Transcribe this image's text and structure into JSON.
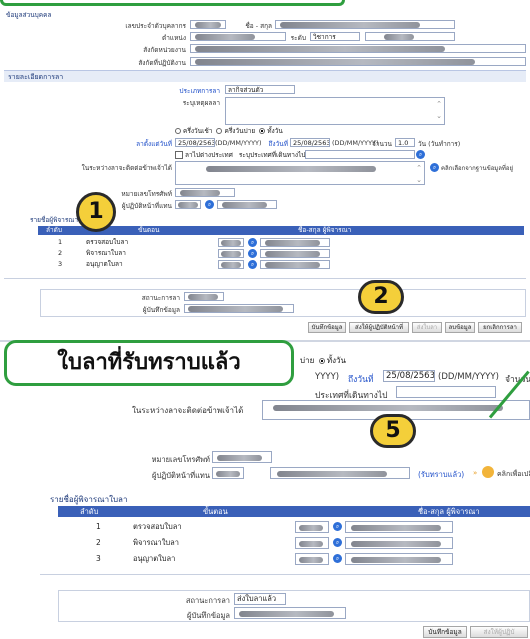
{
  "top": {
    "personal_header": "ข้อมูลส่วนบุคคล",
    "id_label": "เลขประจำตัวบุคลากร",
    "name_label": "ชื่อ - สกุล",
    "position_label": "ตำแหน่ง",
    "level_label": "ระดับ",
    "level_value": "วิชาการ",
    "org_label": "สังกัดหน่วยงาน",
    "org2_label": "สังกัดที่ปฏิบัติงาน",
    "leave_header": "รายละเอียดการลา",
    "leave_type_label": "ประเภทการลา",
    "leave_type_value": "ลากิจส่วนตัว",
    "reason_label": "ระบุเหตุผลลา",
    "radio_morning": "ครึ่งวันเช้า",
    "radio_afternoon": "ครึ่งวันบ่าย",
    "radio_full": "ทั้งวัน",
    "from_label": "ลาตั้งแต่วันที่",
    "from_date": "25/08/2563",
    "date_format": "(DD/MM/YYYY)",
    "to_label": "ถึงวันที่",
    "to_date": "25/08/2563",
    "days_label": "จำนวน",
    "days_value": "1.0",
    "days_unit": "วัน (วันทำการ)",
    "abroad_label": "ลาไปต่างประเทศ",
    "abroad_purpose_label": "ระบุประเทศที่เดินทางไป",
    "contact_label": "ในระหว่างลาจะติดต่อข้าพเจ้าได้",
    "contact_link": "คลิกเลือกจากฐานข้อมูลที่อยู่",
    "phone_label": "หมายเลขโทรศัพท์",
    "phone_value": "0xxxxxxxxx",
    "deputy_label": "ผู้ปฏิบัติหน้าที่แทน",
    "approver_header": "รายชื่อผู้พิจารณาใบลา",
    "col_order": "ลำดับ",
    "col_step": "ขั้นตอน",
    "col_name": "ชื่อ-สกุล ผู้พิจารณา",
    "rows": [
      {
        "no": "1",
        "step": "ตรวจสอบใบลา"
      },
      {
        "no": "2",
        "step": "พิจารณาใบลา"
      },
      {
        "no": "3",
        "step": "อนุญาตใบลา"
      }
    ],
    "status_label": "สถานะการลา",
    "recorder_label": "ผู้บันทึกข้อมูล",
    "buttons": [
      "บันทึกข้อมูล",
      "ส่งให้ผู้ปฏิบัติหน้าที่",
      "ส่งใบลา",
      "ลบข้อมูล",
      "ยกเลิกการลา"
    ]
  },
  "callout": {
    "text": "ใบลาที่รับทราบแล้ว"
  },
  "badges": {
    "b1": "1",
    "b2": "2",
    "b5": "5"
  },
  "bottom": {
    "radio_afternoon": "บ่าย",
    "radio_full": "ทั้งวัน",
    "date_format_partial": "YYYY)",
    "to_label": "ถึงวันที่",
    "to_date": "25/08/2563",
    "date_format": "(DD/MM/YYYY)",
    "days_partial": "จำนวน",
    "abroad_partial": "ประเทศที่เดินทางไป",
    "contact_partial": "ในระหว่างลาจะติดต่อข้าพเจ้าได้",
    "phone_label": "หมายเลขโทรศัพท์",
    "deputy_label": "ผู้ปฏิบัติหน้าที่แทน",
    "ack_status": "(รับทราบแล้ว)",
    "change_link": "คลิกเพื่อเปลี่ยนผู้ปฏิ",
    "approver_header": "รายชื่อผู้พิจารณาใบลา",
    "col_order": "ลำดับ",
    "col_step": "ขั้นตอน",
    "col_name": "ชื่อ-สกุล ผู้พิจารณา",
    "rows": [
      {
        "no": "1",
        "step": "ตรวจสอบใบลา"
      },
      {
        "no": "2",
        "step": "พิจารณาใบลา"
      },
      {
        "no": "3",
        "step": "อนุญาตใบลา"
      }
    ],
    "status_label": "สถานะการลา",
    "status_value": "ส่งใบลาแล้ว",
    "recorder_label": "ผู้บันทึกข้อมูล",
    "buttons": [
      "บันทึกข้อมูล",
      "ส่งให้ผู้ปฏิบั"
    ]
  },
  "colors": {
    "accent": "#3a60b8",
    "callout_border": "#2f9e3f",
    "badge": "#f4cf3a",
    "link": "#1f4fc9"
  }
}
